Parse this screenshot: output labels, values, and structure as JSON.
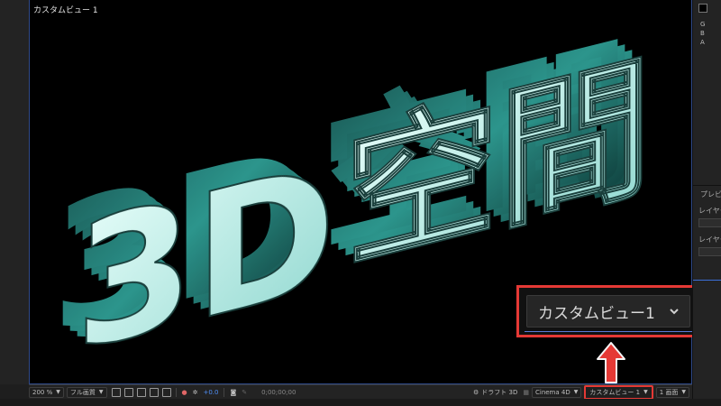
{
  "viewer": {
    "view_label": "カスタムビュー 1",
    "artwork_text": "3D空間"
  },
  "callout": {
    "dropdown_value": "カスタムビュー1"
  },
  "right_panel": {
    "letters": [
      "G",
      "B",
      "A"
    ],
    "preview_label": "プレビ",
    "layer_label_1": "レイヤー",
    "layer_label_2": "レイヤー"
  },
  "toolbar": {
    "zoom": "200 %",
    "resolution": "フル画質",
    "exposure": "+0.0",
    "timecode": "0;00;00;00",
    "draft3d": "ドラフト 3D",
    "renderer": "Cinema 4D",
    "view": "カスタムビュー 1",
    "layout": "1 画面"
  },
  "colors": {
    "highlight": "#e53935",
    "accent_blue": "#3b6fd8",
    "extrude_face": "#c9f4ef",
    "extrude_side": "#2a8d86"
  }
}
